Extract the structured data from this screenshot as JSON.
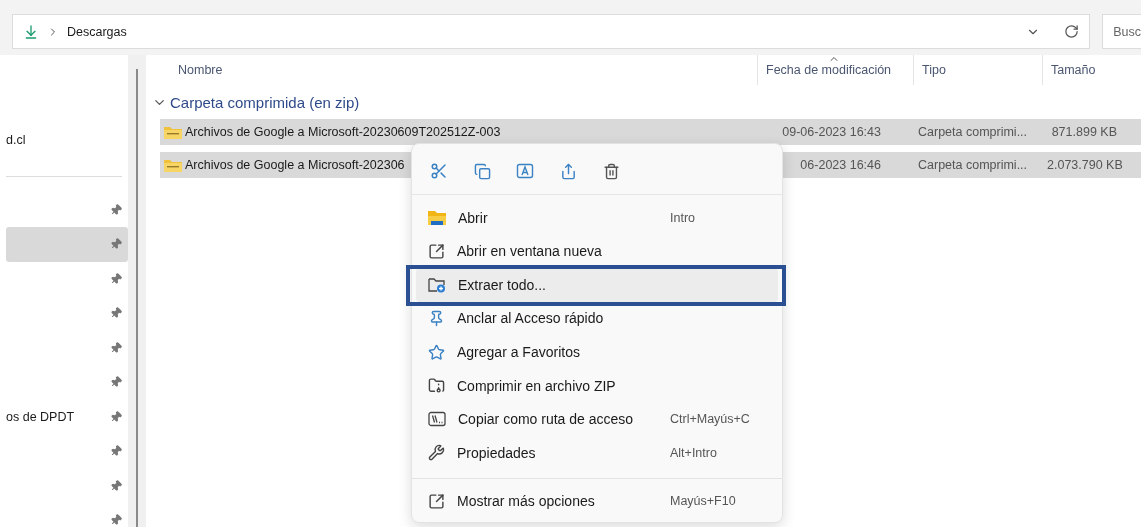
{
  "address_bar": {
    "path": [
      "Descargas"
    ],
    "search_placeholder": "Busc"
  },
  "sidebar": {
    "items": [
      {
        "label": "d.cl",
        "pinned": false,
        "selected": false
      },
      {
        "pinned": true,
        "selected": false
      },
      {
        "pinned": true,
        "selected": true
      },
      {
        "pinned": true,
        "selected": false
      },
      {
        "pinned": true,
        "selected": false
      },
      {
        "pinned": true,
        "selected": false
      },
      {
        "pinned": true,
        "selected": false
      },
      {
        "label": "os de DPDT",
        "pinned": true,
        "selected": false
      },
      {
        "pinned": true,
        "selected": false
      },
      {
        "pinned": true,
        "selected": false
      },
      {
        "pinned": true,
        "selected": false
      }
    ]
  },
  "table": {
    "columns": [
      {
        "label": "Nombre",
        "sorted": false
      },
      {
        "label": "Fecha de modificación",
        "sorted": true
      },
      {
        "label": "Tipo",
        "sorted": false
      },
      {
        "label": "Tamaño",
        "sorted": false
      }
    ],
    "group": {
      "label": "Carpeta comprimida (en zip)",
      "expanded": true
    },
    "rows": [
      {
        "name": "Archivos de Google a Microsoft-20230609T202512Z-003",
        "modified": "09-06-2023 16:43",
        "type": "Carpeta comprimi...",
        "size": "871.899 KB",
        "selected": true
      },
      {
        "name": "Archivos de Google a Microsoft-202306",
        "modified": "06-2023 16:46",
        "type": "Carpeta comprimi...",
        "size": "2.073.790 KB",
        "selected": true
      }
    ]
  },
  "context_menu": {
    "items": [
      {
        "label": "Abrir",
        "shortcut": "Intro",
        "highlighted": false
      },
      {
        "label": "Abrir en ventana nueva",
        "highlighted": false
      },
      {
        "label": "Extraer todo...",
        "highlighted": true
      },
      {
        "label": "Anclar al Acceso rápido",
        "highlighted": false
      },
      {
        "label": "Agregar a Favoritos",
        "highlighted": false
      },
      {
        "label": "Comprimir en archivo ZIP",
        "highlighted": false
      },
      {
        "label": "Copiar como ruta de acceso",
        "shortcut": "Ctrl+Mayús+C",
        "highlighted": false
      },
      {
        "label": "Propiedades",
        "shortcut": "Alt+Intro",
        "highlighted": false
      }
    ],
    "footer_item": {
      "label": "Mostrar más opciones",
      "shortcut": "Mayús+F10"
    }
  }
}
